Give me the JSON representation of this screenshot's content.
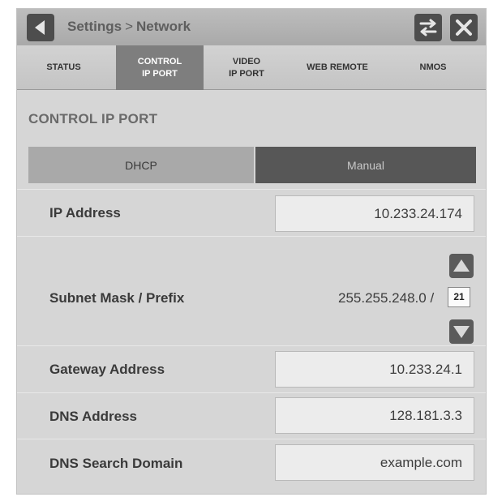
{
  "header": {
    "breadcrumb_parent": "Settings",
    "breadcrumb_separator": ">",
    "breadcrumb_current": "Network",
    "back_icon": "back-arrow-icon",
    "swap_icon": "swap-arrows-icon",
    "close_icon": "close-icon"
  },
  "tabs": [
    {
      "label": "STATUS",
      "active": false
    },
    {
      "label": "CONTROL\nIP PORT",
      "active": true
    },
    {
      "label": "VIDEO\nIP PORT",
      "active": false
    },
    {
      "label": "WEB REMOTE",
      "active": false
    },
    {
      "label": "NMOS",
      "active": false
    }
  ],
  "section": {
    "title": "CONTROL IP PORT"
  },
  "mode": {
    "dhcp_label": "DHCP",
    "manual_label": "Manual",
    "selected": "Manual"
  },
  "fields": {
    "ip_address": {
      "label": "IP Address",
      "value": "10.233.24.174"
    },
    "subnet": {
      "label": "Subnet Mask / Prefix",
      "value": "255.255.248.0 /",
      "prefix": "21"
    },
    "gateway": {
      "label": "Gateway Address",
      "value": "10.233.24.1"
    },
    "dns": {
      "label": "DNS Address",
      "value": "128.181.3.3"
    },
    "dns_search": {
      "label": "DNS Search Domain",
      "value": "example.com"
    }
  },
  "colors": {
    "active_tab": "#7e7e7e",
    "manual_selected": "#575757",
    "dhcp": "#a9a9a9"
  }
}
